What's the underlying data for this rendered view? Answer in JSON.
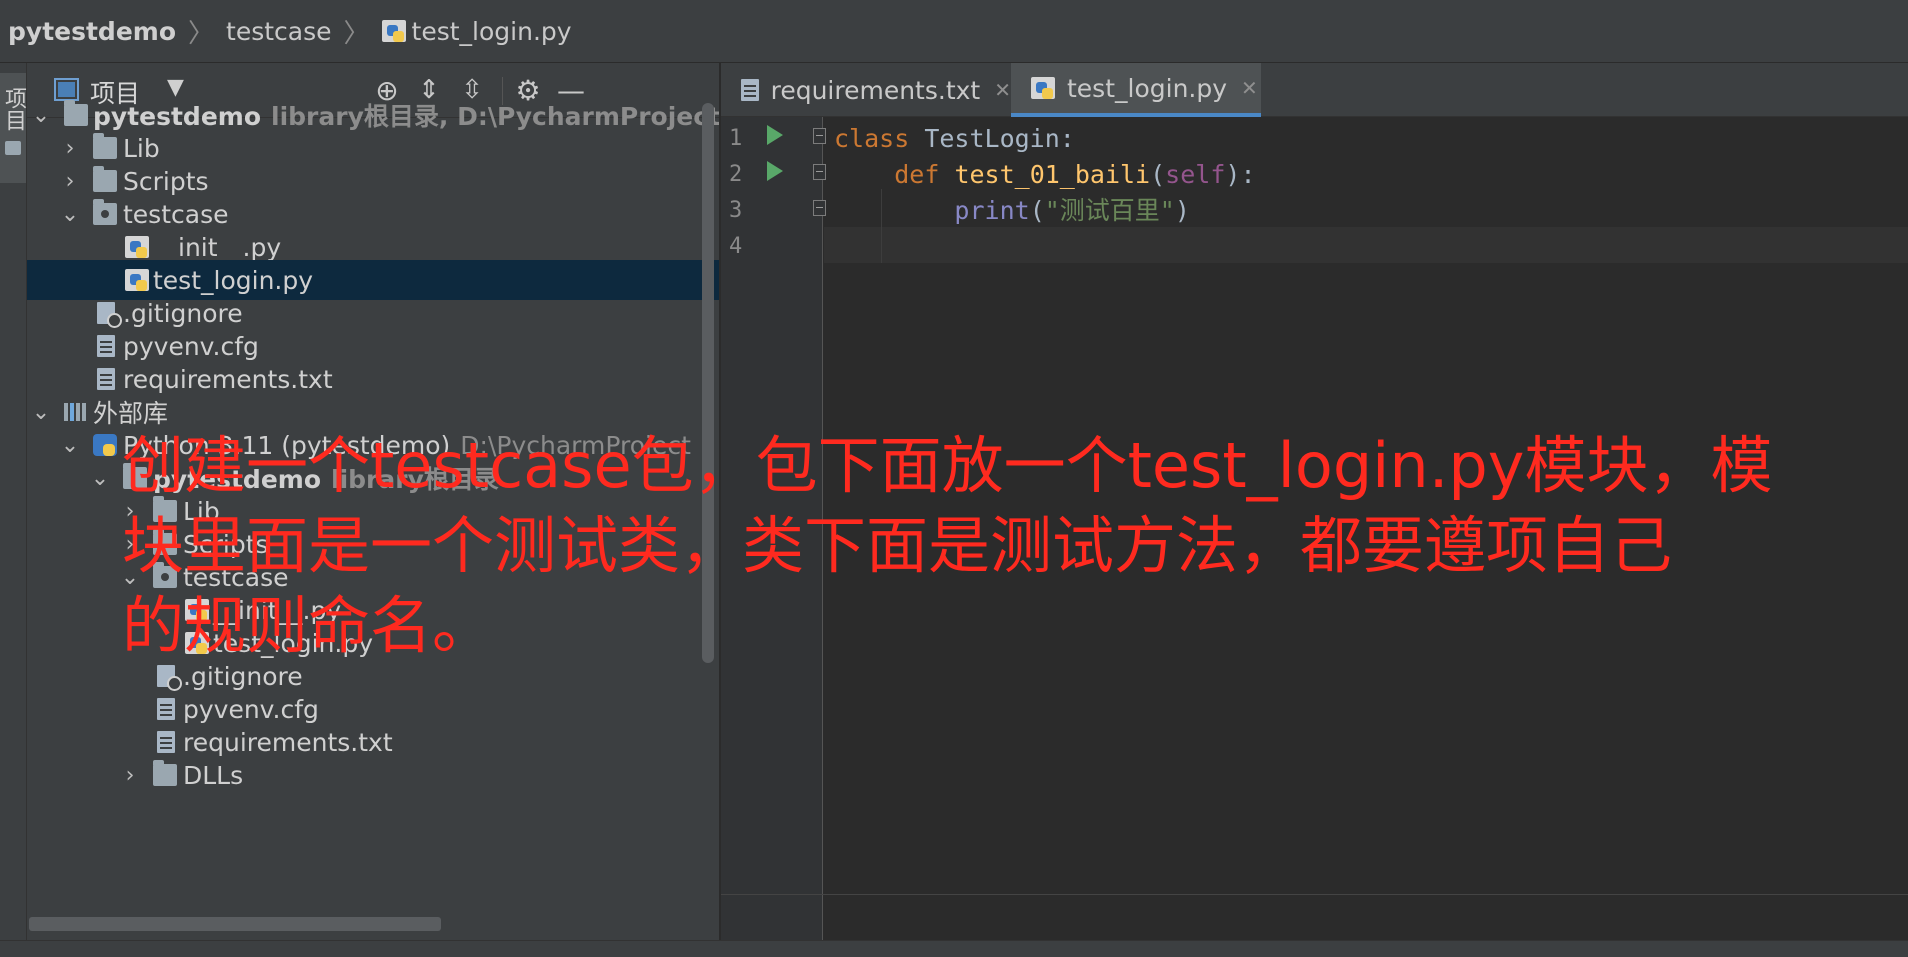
{
  "breadcrumb": {
    "project": "pytestdemo",
    "folder": "testcase",
    "file": "test_login.py"
  },
  "left_stripe": {
    "label": "项目"
  },
  "project_panel": {
    "title": "项目",
    "dropdown": "▼",
    "tools": [
      "locate-icon",
      "expand-all-icon",
      "collapse-all-icon",
      "gear-icon",
      "hide-icon"
    ],
    "tree": {
      "root_label": "pytestdemo",
      "root_hint": "library根目录,  D:\\PycharmProjects\\pyte",
      "lib": "Lib",
      "scripts": "Scripts",
      "testcase": "testcase",
      "init": "__init__.py",
      "test_login": "test_login.py",
      "gitignore": ".gitignore",
      "pyvenv": "pyvenv.cfg",
      "requirements": "requirements.txt",
      "external": "外部库",
      "python": "Python 3.11 (pytestdemo)",
      "python_hint": "D:\\PycharmProject",
      "ext_root_label": "pytestdemo",
      "ext_root_hint": "library根目录",
      "ext_lib": "Lib",
      "ext_scripts": "Scripts",
      "ext_testcase": "testcase",
      "ext_init": "__init__.py",
      "ext_test_login": "test_login.py",
      "ext_gitignore": ".gitignore",
      "ext_pyvenv": "pyvenv.cfg",
      "ext_requirements": "requirements.txt",
      "ext_dlls": "DLLs"
    }
  },
  "editor": {
    "tabs": [
      {
        "label": "requirements.txt",
        "close": "✕",
        "active": false
      },
      {
        "label": "test_login.py",
        "close": "✕",
        "active": true
      }
    ],
    "line_numbers": [
      "1",
      "2",
      "3",
      "4"
    ],
    "code": {
      "l1_kw": "class",
      "l1_name": " TestLogin:",
      "l2_indent": "    ",
      "l2_kw": "def",
      "l2_space": " ",
      "l2_fn": "test_01_baili",
      "l2_open": "(",
      "l2_self": "self",
      "l2_close": "):",
      "l3_indent": "        ",
      "l3_builtin": "print",
      "l3_open": "(",
      "l3_str": "\"测试百里\"",
      "l3_close": ")"
    }
  },
  "annotation": {
    "line1": "创建一个testcase包，包下面放一个test_login.py模块，模",
    "line2": "块里面是一个测试类，类下面是测试方法，都要遵项自己",
    "line3": "的规则命名。"
  },
  "colors": {
    "annotation": "#ff2a1f",
    "keyword": "#cc7832",
    "function": "#ffc66d",
    "string": "#6a8759",
    "selected_row": "#0d293e",
    "run_icon": "#59a869"
  }
}
